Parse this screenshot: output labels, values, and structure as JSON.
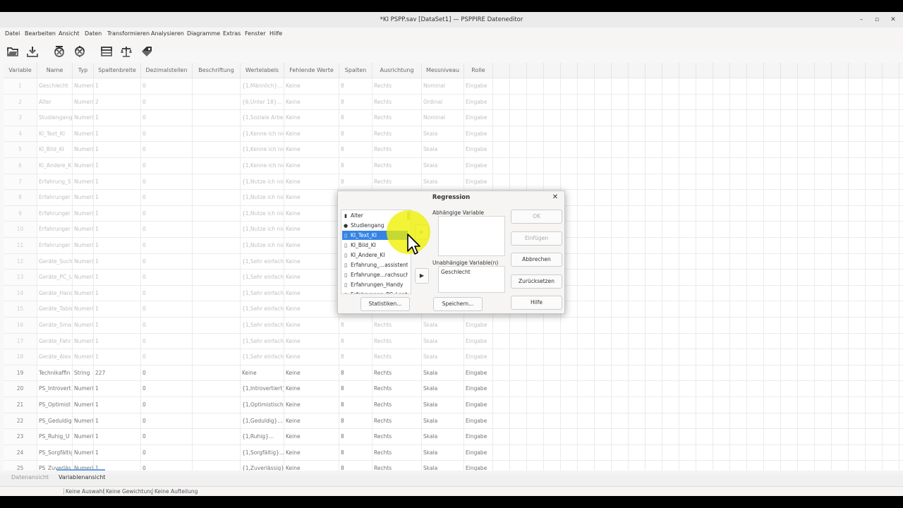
{
  "window": {
    "title": "*KI PSPP.sav [DataSet1] — PSPPIRE Dateneditor"
  },
  "window_controls": {
    "minimize": "–",
    "maximize": "▫",
    "close": "✕"
  },
  "menu": [
    "Datei",
    "Bearbeiten",
    "Ansicht",
    "Daten",
    "Transformieren",
    "Analysieren",
    "Diagramme",
    "Extras",
    "Fenster",
    "Hilfe"
  ],
  "toolbar_icons": [
    "open-icon",
    "save-icon",
    "goto-case-icon",
    "goto-variable-icon",
    "split-icon",
    "weight-icon",
    "value-labels-icon"
  ],
  "columns": [
    "Variable",
    "Name",
    "Typ",
    "Spaltenbreite",
    "Dezimalstellen",
    "Beschriftung",
    "Wertelabels",
    "Fehlende Werte",
    "Spalten",
    "Ausrichtung",
    "Messniveau",
    "Rolle"
  ],
  "rows": [
    [
      "1",
      "Geschlecht",
      "Numerisc",
      "1",
      "0",
      "",
      "{1,Männlich}...",
      "Keine",
      "8",
      "Rechts",
      "Nominal",
      "Eingabe"
    ],
    [
      "2",
      "Alter",
      "Numerisc",
      "2",
      "0",
      "",
      "{6,Unter 18}...",
      "Keine",
      "8",
      "Rechts",
      "Ordinal",
      "Eingabe"
    ],
    [
      "3",
      "Studiengang",
      "Numerisc",
      "1",
      "0",
      "",
      "{1,Soziale Arbeit}",
      "Keine",
      "8",
      "Rechts",
      "Nominal",
      "Eingabe"
    ],
    [
      "4",
      "KI_Text_KI",
      "Numerisc",
      "1",
      "0",
      "",
      "{1,Kenne ich nicht",
      "Keine",
      "8",
      "Rechts",
      "Skala",
      "Eingabe"
    ],
    [
      "5",
      "KI_Bild_KI",
      "Numerisc",
      "1",
      "0",
      "",
      "{1,Kenne ich nicht",
      "Keine",
      "8",
      "Rechts",
      "Skala",
      "Eingabe"
    ],
    [
      "6",
      "KI_Andere_K",
      "Numerisc",
      "1",
      "0",
      "",
      "{1,Kenne ich nicht",
      "Keine",
      "8",
      "Rechts",
      "Skala",
      "Eingabe"
    ],
    [
      "7",
      "Erfahrung_S",
      "Numerisc",
      "1",
      "0",
      "",
      "{1,Nutze ich nicht",
      "Keine",
      "8",
      "Rechts",
      "Skala",
      "Eingabe"
    ],
    [
      "8",
      "Erfahrunger",
      "Numerisc",
      "1",
      "0",
      "",
      "{1,Nutze ich nicht",
      "Keine",
      "8",
      "Rechts",
      "Skala",
      "Eingabe"
    ],
    [
      "9",
      "Erfahrunger",
      "Numerisc",
      "1",
      "0",
      "",
      "{1,Nutze ich nicht",
      "Keine",
      "8",
      "Rechts",
      "Skala",
      "Eingabe"
    ],
    [
      "10",
      "Erfahrunger",
      "Numerisc",
      "1",
      "0",
      "",
      "{1,Nutze ich nicht",
      "Keine",
      "8",
      "Rechts",
      "Skala",
      "Eingabe"
    ],
    [
      "11",
      "Erfahrunger",
      "Numerisc",
      "1",
      "0",
      "",
      "{1,Nutze ich nicht",
      "Keine",
      "8",
      "Rechts",
      "Skala",
      "Eingabe"
    ],
    [
      "12",
      "Geräte_Such",
      "Numerisc",
      "1",
      "0",
      "",
      "{1,Sehr einfach}...",
      "Keine",
      "8",
      "Rechts",
      "Skala",
      "Eingabe"
    ],
    [
      "13",
      "Geräte_PC_L",
      "Numerisc",
      "1",
      "0",
      "",
      "{1,Sehr einfach}...",
      "Keine",
      "8",
      "Rechts",
      "Skala",
      "Eingabe"
    ],
    [
      "14",
      "Geräte_Hand",
      "Numerisc",
      "1",
      "0",
      "",
      "{1,Sehr einfach}...",
      "Keine",
      "8",
      "Rechts",
      "Skala",
      "Eingabe"
    ],
    [
      "15",
      "Geräte_Table",
      "Numerisc",
      "1",
      "0",
      "",
      "{1,Sehr einfach}...",
      "Keine",
      "8",
      "Rechts",
      "Skala",
      "Eingabe"
    ],
    [
      "16",
      "Geräte_Sma",
      "Numerisc",
      "1",
      "0",
      "",
      "{1,Sehr einfach}...",
      "Keine",
      "8",
      "Rechts",
      "Skala",
      "Eingabe"
    ],
    [
      "17",
      "Geräte_Fahr",
      "Numerisc",
      "1",
      "0",
      "",
      "{1,Sehr einfach}...",
      "Keine",
      "8",
      "Rechts",
      "Skala",
      "Eingabe"
    ],
    [
      "18",
      "Geräte_Alex",
      "Numerisc",
      "1",
      "0",
      "",
      "{1,Sehr einfach}...",
      "Keine",
      "8",
      "Rechts",
      "Skala",
      "Eingabe"
    ],
    [
      "19",
      "Technikaffin",
      "String",
      "227",
      "0",
      "",
      "Keine",
      "Keine",
      "8",
      "Rechts",
      "Skala",
      "Eingabe"
    ],
    [
      "20",
      "PS_Introvert",
      "Numerisc",
      "1",
      "0",
      "",
      "{1,Introvertiert}...",
      "Keine",
      "8",
      "Rechts",
      "Skala",
      "Eingabe"
    ],
    [
      "21",
      "PS_Optimist",
      "Numerisc",
      "1",
      "0",
      "",
      "{1,Optimistisch}...",
      "Keine",
      "8",
      "Rechts",
      "Skala",
      "Eingabe"
    ],
    [
      "22",
      "PS_Geduldig",
      "Numerisc",
      "1",
      "0",
      "",
      "{1,Geduldig}...",
      "Keine",
      "8",
      "Rechts",
      "Skala",
      "Eingabe"
    ],
    [
      "23",
      "PS_Ruhig_U",
      "Numerisc",
      "1",
      "0",
      "",
      "{1,Ruhig}...",
      "Keine",
      "8",
      "Rechts",
      "Skala",
      "Eingabe"
    ],
    [
      "24",
      "PS_Sorgfältig",
      "Numerisc",
      "1",
      "0",
      "",
      "{1,Sorgfältig}...",
      "Keine",
      "8",
      "Rechts",
      "Skala",
      "Eingabe"
    ],
    [
      "25",
      "PS_Zuverläs",
      "Numerisc",
      "1",
      "0",
      "",
      "{1,Zuverlässig}...",
      "Keine",
      "8",
      "Rechts",
      "Skala",
      "Eingabe"
    ]
  ],
  "tabs": {
    "data_view": "Datenansicht",
    "variable_view": "Variablenansicht"
  },
  "status": {
    "filter": "Keine Auswahl",
    "weight": "Keine Gewichtung",
    "split": "Keine Aufteilung"
  },
  "dialog": {
    "title": "Regression",
    "variables": [
      {
        "label": "Alter",
        "icon": "ordinal-icon"
      },
      {
        "label": "Studiengang",
        "icon": "nominal-icon"
      },
      {
        "label": "KI_Text_KI",
        "icon": "scale-icon",
        "selected": true
      },
      {
        "label": "KI_Bild_KI",
        "icon": "scale-icon"
      },
      {
        "label": "KI_Andere_KI",
        "icon": "scale-icon"
      },
      {
        "label": "Erfahrung_...assistenten",
        "icon": "scale-icon"
      },
      {
        "label": "Erfahrunge...rachsuche",
        "icon": "scale-icon"
      },
      {
        "label": "Erfahrungen_Handy",
        "icon": "scale-icon"
      },
      {
        "label": "Erfahrungen_PC_Laptop",
        "icon": "scale-icon"
      }
    ],
    "dependent_label": "Abhängige Variable",
    "independent_label": "Unabhängige Variable(n)",
    "independent_value": "Geschlecht",
    "buttons": {
      "ok": "OK",
      "paste": "Einfügen",
      "cancel": "Abbrechen",
      "reset": "Zurücksetzen",
      "help": "Hilfe",
      "statistics": "Statistiken...",
      "save": "Speichern..."
    }
  }
}
